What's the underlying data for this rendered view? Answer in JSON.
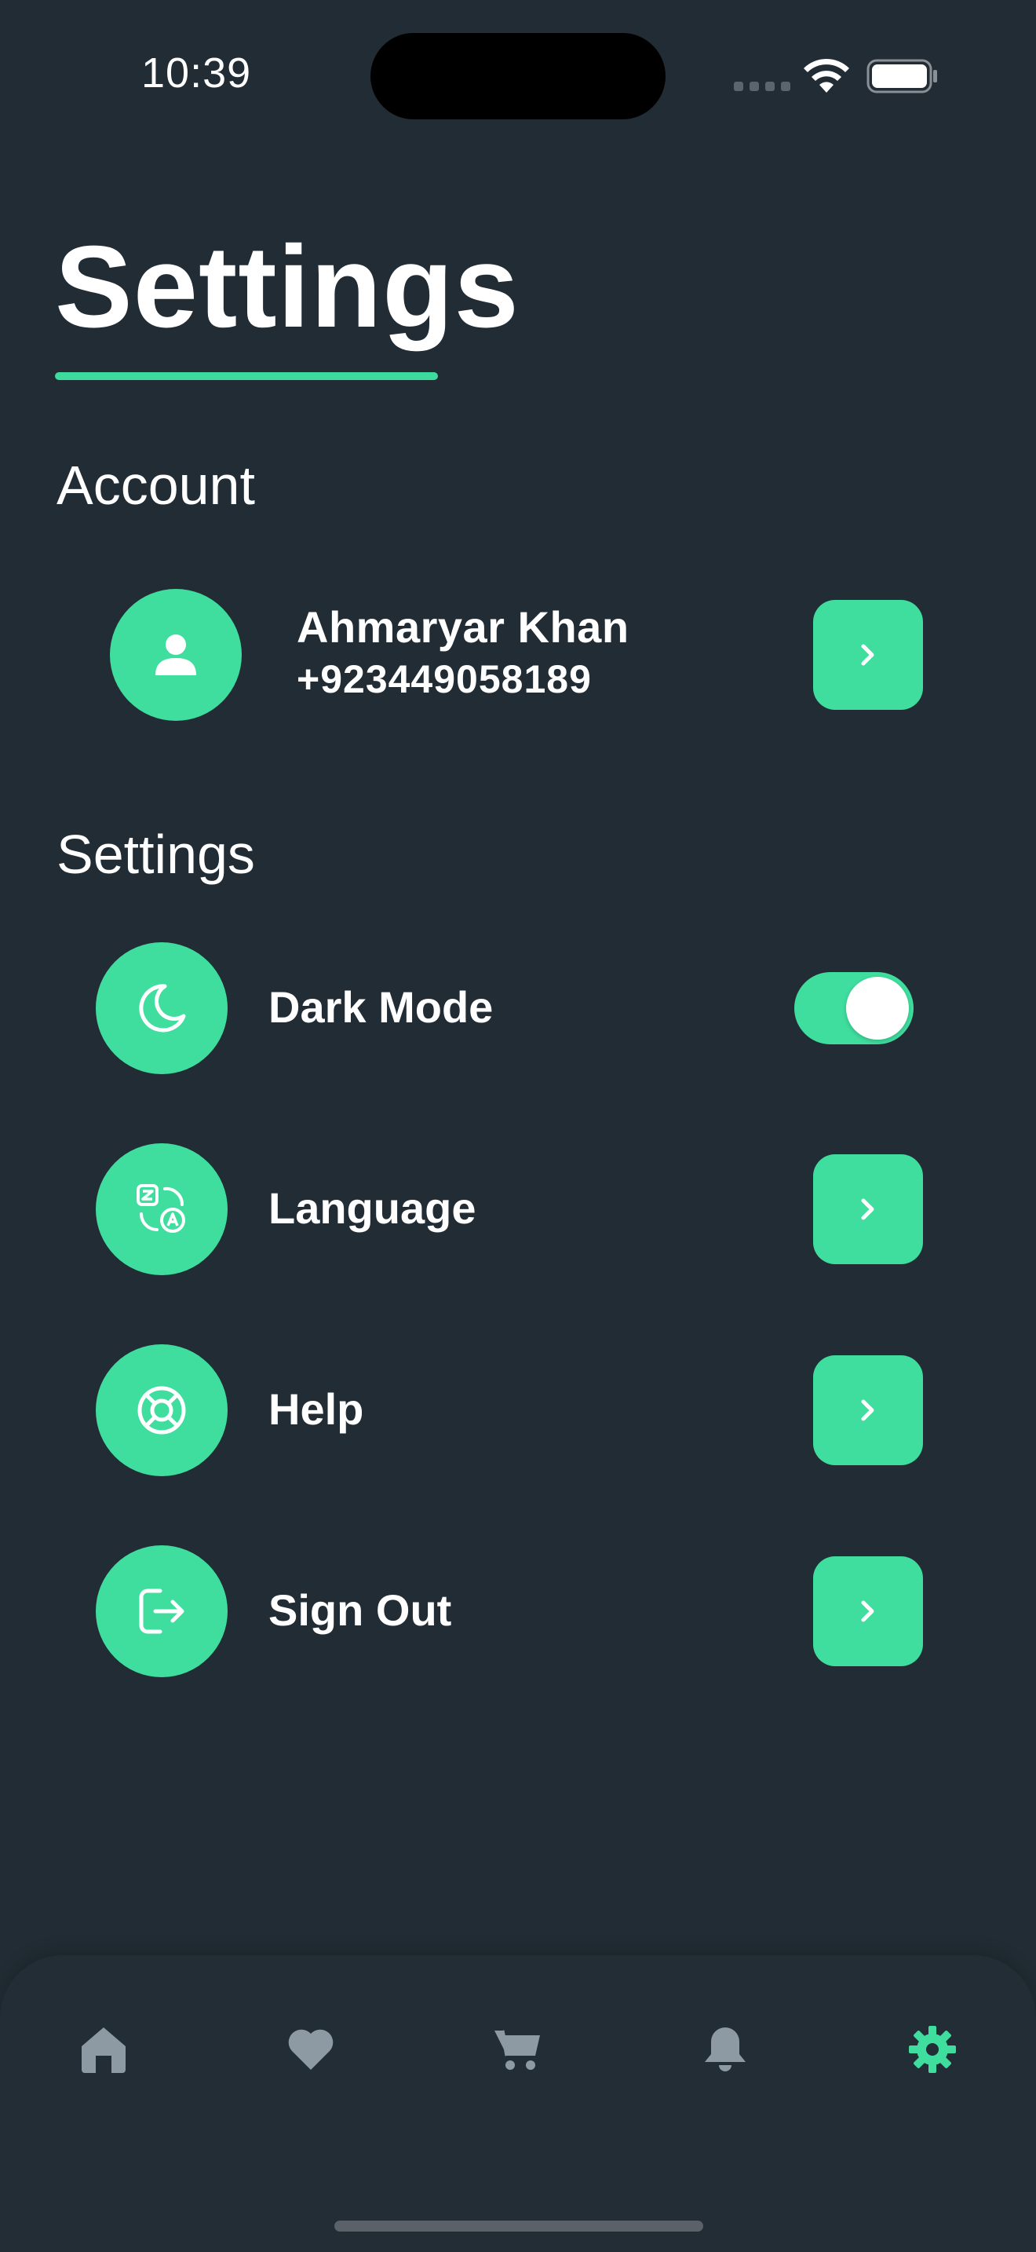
{
  "status_bar": {
    "time": "10:39",
    "signal_icon": "cellular-signal-icon",
    "wifi_icon": "wifi-icon",
    "battery_icon": "battery-icon"
  },
  "page": {
    "title": "Settings"
  },
  "account_section": {
    "label": "Account",
    "profile": {
      "avatar_icon": "user-icon",
      "name": "Ahmaryar Khan",
      "phone": "+923449058189",
      "action_icon": "chevron-right-icon"
    }
  },
  "settings_section": {
    "label": "Settings",
    "items": [
      {
        "label": "Dark Mode",
        "icon": "moon-icon",
        "control": "toggle",
        "toggle_on": true
      },
      {
        "label": "Language",
        "icon": "translate-icon",
        "control": "arrow"
      },
      {
        "label": "Help",
        "icon": "lifebuoy-icon",
        "control": "arrow"
      },
      {
        "label": "Sign Out",
        "icon": "sign-out-icon",
        "control": "arrow"
      }
    ]
  },
  "tab_bar": {
    "tabs": [
      {
        "icon": "home-icon",
        "active": false
      },
      {
        "icon": "heart-icon",
        "active": false
      },
      {
        "icon": "cart-icon",
        "active": false
      },
      {
        "icon": "bell-icon",
        "active": false
      },
      {
        "icon": "gear-icon",
        "active": true
      }
    ]
  },
  "colors": {
    "background": "#212c34",
    "accent": "#3fde9f",
    "text": "#ffffff",
    "inactive_icon": "#8e9aa3"
  }
}
